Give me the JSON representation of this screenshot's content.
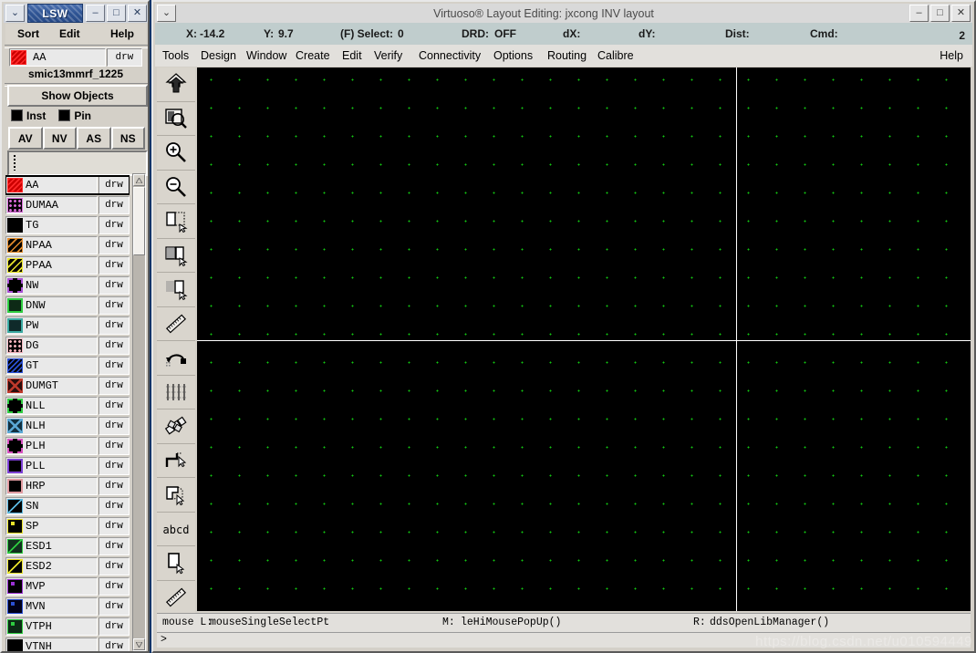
{
  "lsw": {
    "title": "LSW",
    "window_buttons": [
      "⌄",
      "–",
      "□",
      "✕"
    ],
    "menu": {
      "sort": "Sort",
      "edit": "Edit",
      "help": "Help"
    },
    "current_layer": {
      "name": "AA",
      "purpose": "drw"
    },
    "tech_library": "smic13mmrf_1225",
    "show_objects_label": "Show Objects",
    "object_toggles": [
      {
        "label": "Inst",
        "checked": true
      },
      {
        "label": "Pin",
        "checked": true
      }
    ],
    "visibility_buttons": [
      "AV",
      "NV",
      "AS",
      "NS"
    ],
    "layers": [
      {
        "name": "AA",
        "purpose": "drw",
        "fill": "#cc0000",
        "stroke": "#ff2a2a",
        "pattern": "diag-dense",
        "selected": true
      },
      {
        "name": "DUMAA",
        "purpose": "drw",
        "fill": "#000000",
        "stroke": "#d96ad9",
        "pattern": "dots-big",
        "selected": false
      },
      {
        "name": "TG",
        "purpose": "drw",
        "fill": "#000000",
        "stroke": "#000000",
        "pattern": "solid",
        "selected": false
      },
      {
        "name": "NPAA",
        "purpose": "drw",
        "fill": "#000000",
        "stroke": "#e08a2a",
        "pattern": "diag-wide",
        "selected": false
      },
      {
        "name": "PPAA",
        "purpose": "drw",
        "fill": "#000000",
        "stroke": "#e8e22a",
        "pattern": "diag-wide",
        "selected": false
      },
      {
        "name": "NW",
        "purpose": "drw",
        "fill": "#000000",
        "stroke": "#a84fd4",
        "pattern": "dashed",
        "selected": false
      },
      {
        "name": "DNW",
        "purpose": "drw",
        "fill": "#0d2a16",
        "stroke": "#2ecc40",
        "pattern": "outline",
        "selected": false
      },
      {
        "name": "PW",
        "purpose": "drw",
        "fill": "#0f2a2a",
        "stroke": "#3aa8a0",
        "pattern": "outline",
        "selected": false
      },
      {
        "name": "DG",
        "purpose": "drw",
        "fill": "#000000",
        "stroke": "#f2b3bc",
        "pattern": "dots-big",
        "selected": false
      },
      {
        "name": "GT",
        "purpose": "drw",
        "fill": "#000000",
        "stroke": "#2a4fd4",
        "pattern": "diag-dense",
        "selected": false
      },
      {
        "name": "DUMGT",
        "purpose": "drw",
        "fill": "#2a0d0d",
        "stroke": "#c0392b",
        "pattern": "cross",
        "selected": false
      },
      {
        "name": "NLL",
        "purpose": "drw",
        "fill": "#000000",
        "stroke": "#2ecc40",
        "pattern": "dashed",
        "selected": false
      },
      {
        "name": "NLH",
        "purpose": "drw",
        "fill": "#123040",
        "stroke": "#5aa8d6",
        "pattern": "cross",
        "selected": false
      },
      {
        "name": "PLH",
        "purpose": "drw",
        "fill": "#000000",
        "stroke": "#d64fbf",
        "pattern": "dashed",
        "selected": false
      },
      {
        "name": "PLL",
        "purpose": "drw",
        "fill": "#000000",
        "stroke": "#7d3fd4",
        "pattern": "outline",
        "selected": false
      },
      {
        "name": "HRP",
        "purpose": "drw",
        "fill": "#000000",
        "stroke": "#e09aa0",
        "pattern": "outline",
        "selected": false
      },
      {
        "name": "SN",
        "purpose": "drw",
        "fill": "#000000",
        "stroke": "#5ab8e0",
        "pattern": "diag-one",
        "selected": false
      },
      {
        "name": "SP",
        "purpose": "drw",
        "fill": "#000000",
        "stroke": "#e8e22a",
        "pattern": "dot-center",
        "selected": false
      },
      {
        "name": "ESD1",
        "purpose": "drw",
        "fill": "#12301e",
        "stroke": "#2ecc40",
        "pattern": "diag-one",
        "selected": false
      },
      {
        "name": "ESD2",
        "purpose": "drw",
        "fill": "#000000",
        "stroke": "#e8e22a",
        "pattern": "diag-one",
        "selected": false
      },
      {
        "name": "MVP",
        "purpose": "drw",
        "fill": "#000000",
        "stroke": "#9b30d4",
        "pattern": "dot-center",
        "selected": false
      },
      {
        "name": "MVN",
        "purpose": "drw",
        "fill": "#000018",
        "stroke": "#2a4fd4",
        "pattern": "dot-center",
        "selected": false
      },
      {
        "name": "VTPH",
        "purpose": "drw",
        "fill": "#0d2a16",
        "stroke": "#2ecc40",
        "pattern": "dot-center",
        "selected": false
      },
      {
        "name": "VTNH",
        "purpose": "drw",
        "fill": "#000000",
        "stroke": "#000000",
        "pattern": "solid",
        "selected": false
      }
    ]
  },
  "virtuoso": {
    "title": "Virtuoso® Layout Editing: jxcong INV layout",
    "window_buttons": [
      "⌄",
      "–",
      "□",
      "✕"
    ],
    "status": {
      "x_label": "X:",
      "x_value": "-14.2",
      "y_label": "Y:",
      "y_value": "9.7",
      "select_label": "(F) Select:",
      "select_value": "0",
      "drd_label": "DRD:",
      "drd_value": "OFF",
      "dx_label": "dX:",
      "dx_value": "",
      "dy_label": "dY:",
      "dy_value": "",
      "dist_label": "Dist:",
      "dist_value": "",
      "cmd_label": "Cmd:",
      "cmd_value": "",
      "counter": "2"
    },
    "menus": [
      "Tools",
      "Design",
      "Window",
      "Create",
      "Edit",
      "Verify",
      "Connectivity",
      "Options",
      "Routing",
      "Calibre"
    ],
    "help_label": "Help",
    "toolbar": [
      "save-icon",
      "zoom-fit-icon",
      "zoom-in-icon",
      "zoom-out-icon",
      "stretch-icon",
      "copy-icon",
      "move-icon",
      "ruler-icon",
      "undo-icon",
      "align-icon",
      "chop-icon",
      "path-icon",
      "polygon-icon",
      "label-icon",
      "rectangle-icon",
      "measure-icon"
    ],
    "canvas": {
      "background": "#000000",
      "grid_dot_color": "#12c912",
      "axis_color": "#ffffff",
      "grid_spacing_px": 31
    },
    "message_bar": {
      "mouse_label": "mouse L:",
      "left_binding": "mouseSingleSelectPt",
      "middle_label": "M:",
      "middle_binding": "leHiMousePopUp()",
      "right_label": "R:",
      "right_binding": "ddsOpenLibManager()"
    },
    "command_prompt": ">"
  },
  "watermark": "https://blog.csdn.net/u010594449"
}
